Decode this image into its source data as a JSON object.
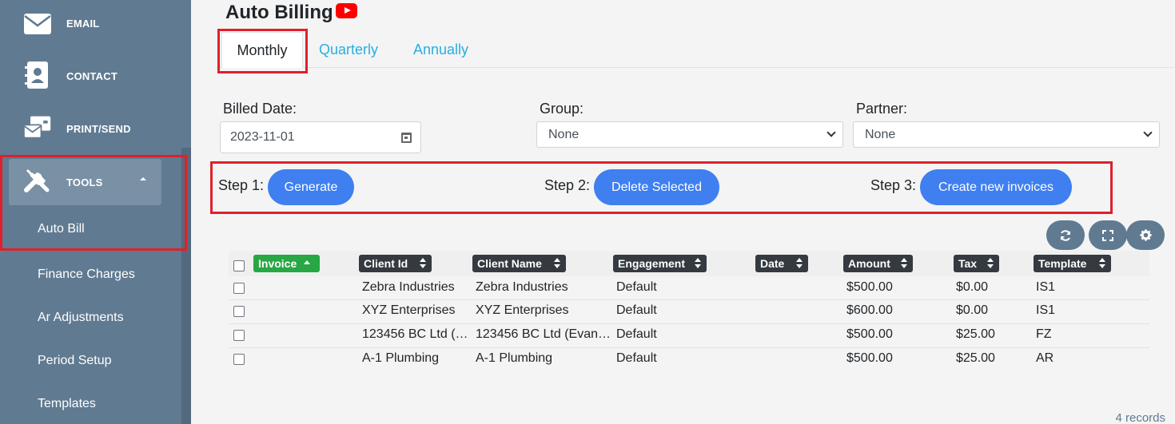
{
  "sidebar": {
    "items": [
      {
        "label": "EMAIL",
        "icon": "envelope-icon"
      },
      {
        "label": "CONTACT",
        "icon": "contact-book-icon"
      },
      {
        "label": "PRINT/SEND",
        "icon": "print-send-icon"
      },
      {
        "label": "TOOLS",
        "icon": "tools-icon"
      }
    ],
    "subitems": [
      "Auto Bill",
      "Finance Charges",
      "Ar Adjustments",
      "Period Setup",
      "Templates"
    ]
  },
  "page": {
    "title": "Auto Billing",
    "video_icon": "youtube-icon"
  },
  "tabs": [
    "Monthly",
    "Quarterly",
    "Annually"
  ],
  "filters": {
    "billed_date_label": "Billed Date:",
    "billed_date_value": "2023-11-01",
    "group_label": "Group:",
    "group_value": "None",
    "partner_label": "Partner:",
    "partner_value": "None"
  },
  "steps": [
    {
      "label": "Step 1:",
      "button": "Generate"
    },
    {
      "label": "Step 2:",
      "button": "Delete Selected"
    },
    {
      "label": "Step 3:",
      "button": "Create new invoices"
    }
  ],
  "table_tools": [
    "refresh-icon",
    "fullscreen-icon",
    "settings-icon"
  ],
  "table": {
    "columns": [
      "Invoice",
      "Client Id",
      "Client Name",
      "Engagement",
      "Date",
      "Amount",
      "Tax",
      "Template"
    ],
    "rows": [
      {
        "invoice": "",
        "client_id": "Zebra Industries",
        "client_name": "Zebra Industries",
        "engagement": "Default",
        "date": "",
        "amount": "$500.00",
        "tax": "$0.00",
        "template": "IS1"
      },
      {
        "invoice": "",
        "client_id": "XYZ Enterprises",
        "client_name": "XYZ Enterprises",
        "engagement": "Default",
        "date": "",
        "amount": "$600.00",
        "tax": "$0.00",
        "template": "IS1"
      },
      {
        "invoice": "",
        "client_id": "123456 BC Ltd (…",
        "client_name": "123456 BC Ltd (Evan…",
        "engagement": "Default",
        "date": "",
        "amount": "$500.00",
        "tax": "$25.00",
        "template": "FZ"
      },
      {
        "invoice": "",
        "client_id": "A-1 Plumbing",
        "client_name": "A-1 Plumbing",
        "engagement": "Default",
        "date": "",
        "amount": "$500.00",
        "tax": "$25.00",
        "template": "AR"
      }
    ],
    "record_count": "4 records"
  },
  "colors": {
    "sidebar": "#607a91",
    "primary_button": "#3f7ff0",
    "tab_link": "#28aee0",
    "highlight": "#e0202a",
    "sorted_header": "#28a745",
    "header": "#343a40"
  }
}
